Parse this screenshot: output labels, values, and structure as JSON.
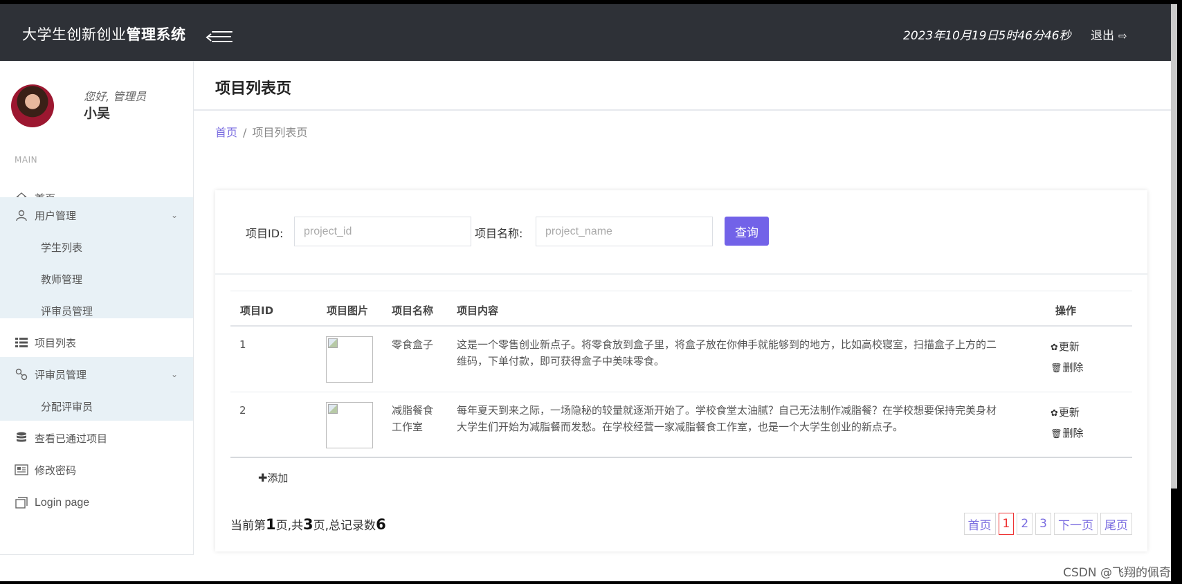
{
  "header": {
    "brand_light": "大学生创新创业",
    "brand_bold": "管理系统",
    "datetime": "2023年10月19日5时46分46秒",
    "logout_label": "退出"
  },
  "profile": {
    "greeting": "您好, 管理员",
    "name": "小吴"
  },
  "sidebar": {
    "section": "MAIN",
    "home": "首页",
    "user_mgmt": "用户管理",
    "user_mgmt_items": [
      "学生列表",
      "教师管理",
      "评审员管理"
    ],
    "project_list": "项目列表",
    "reviewer_mgmt": "评审员管理",
    "reviewer_mgmt_items": [
      "分配评审员"
    ],
    "approved": "查看已通过项目",
    "change_password": "修改密码",
    "login_page": "Login page"
  },
  "main": {
    "title": "项目列表页",
    "breadcrumb": {
      "home": "首页",
      "sep": "/",
      "current": "项目列表页"
    }
  },
  "search": {
    "id_label": "项目ID:",
    "id_placeholder": "project_id",
    "name_label": "项目名称:",
    "name_placeholder": "project_name",
    "button": "查询"
  },
  "table": {
    "headers": [
      "项目ID",
      "项目图片",
      "项目名称",
      "项目内容",
      "操作"
    ],
    "rows": [
      {
        "id": "1",
        "name": "零食盒子",
        "content_line1": "这是一个零售创业新点子。将零食放到盒子里，将盒子放在你伸手就能够到的地方，比如高校寝室，扫描盒子上方的二",
        "content_line2": "维码，下单付款，即可获得盒子中美味零食。",
        "update": "更新",
        "delete": "删除"
      },
      {
        "id": "2",
        "name_line1": "减脂餐食",
        "name_line2": "工作室",
        "content_line1": "每年夏天到来之际，一场隐秘的较量就逐渐开始了。学校食堂太油腻？自己无法制作减脂餐？在学校想要保持完美身材",
        "content_line2": "大学生们开始为减脂餐而发愁。在学校经营一家减脂餐食工作室，也是一个大学生创业的新点子。",
        "update": "更新",
        "delete": "删除"
      }
    ],
    "add_label": "添加"
  },
  "pagination": {
    "info_prefix": "当前第",
    "current": "1",
    "info_mid": "页,共",
    "total_pages": "3",
    "info_mid2": "页,总记录数",
    "total_records": "6",
    "first": "首页",
    "pages": [
      "1",
      "2",
      "3"
    ],
    "next": "下一页",
    "last": "尾页"
  },
  "watermark": "CSDN @飞翔的佩奇",
  "colors": {
    "topbar": "#2e3137",
    "accent": "#7262e8",
    "active_page": "#e33333",
    "sub_menu_bg": "#e8f1f6"
  }
}
